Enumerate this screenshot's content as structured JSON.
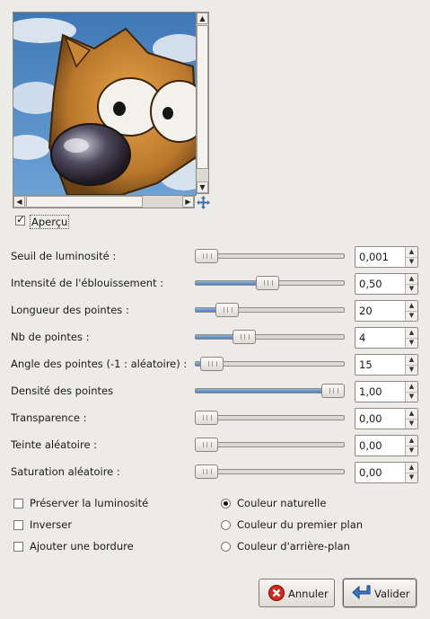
{
  "preview": {
    "checkbox_label": "Aperçu",
    "checked": true
  },
  "params": [
    {
      "label": "Seuil de luminosité :",
      "value": "0,001",
      "fraction": 0.0
    },
    {
      "label": "Intensité de l'éblouissement :",
      "value": "0,50",
      "fraction": 0.48
    },
    {
      "label": "Longueur des pointes :",
      "value": "20",
      "fraction": 0.16
    },
    {
      "label": "Nb de pointes :",
      "value": "4",
      "fraction": 0.3
    },
    {
      "label": "Angle des pointes (-1 : aléatoire) :",
      "value": "15",
      "fraction": 0.04
    },
    {
      "label": "Densité des pointes",
      "value": "1,00",
      "fraction": 1.0
    },
    {
      "label": "Transparence :",
      "value": "0,00",
      "fraction": 0.0
    },
    {
      "label": "Teinte aléatoire :",
      "value": "0,00",
      "fraction": 0.0
    },
    {
      "label": "Saturation aléatoire :",
      "value": "0,00",
      "fraction": 0.0
    }
  ],
  "options": {
    "checkboxes": [
      {
        "label": "Préserver la luminosité",
        "checked": false
      },
      {
        "label": "Inverser",
        "checked": false
      },
      {
        "label": "Ajouter une bordure",
        "checked": false
      }
    ],
    "radios": [
      {
        "label": "Couleur naturelle",
        "selected": true
      },
      {
        "label": "Couleur du premier plan",
        "selected": false
      },
      {
        "label": "Couleur d'arrière-plan",
        "selected": false
      }
    ]
  },
  "buttons": {
    "cancel_label": "Annuler",
    "ok_label": "Valider"
  },
  "colors": {
    "slider_fill": "#4f7fbb",
    "cancel_icon": "#d42a1e",
    "ok_icon": "#3f78c8"
  },
  "icons": {
    "cancel": "cancel-icon",
    "ok": "ok-arrow-icon",
    "navigate": "navigate-icon"
  }
}
